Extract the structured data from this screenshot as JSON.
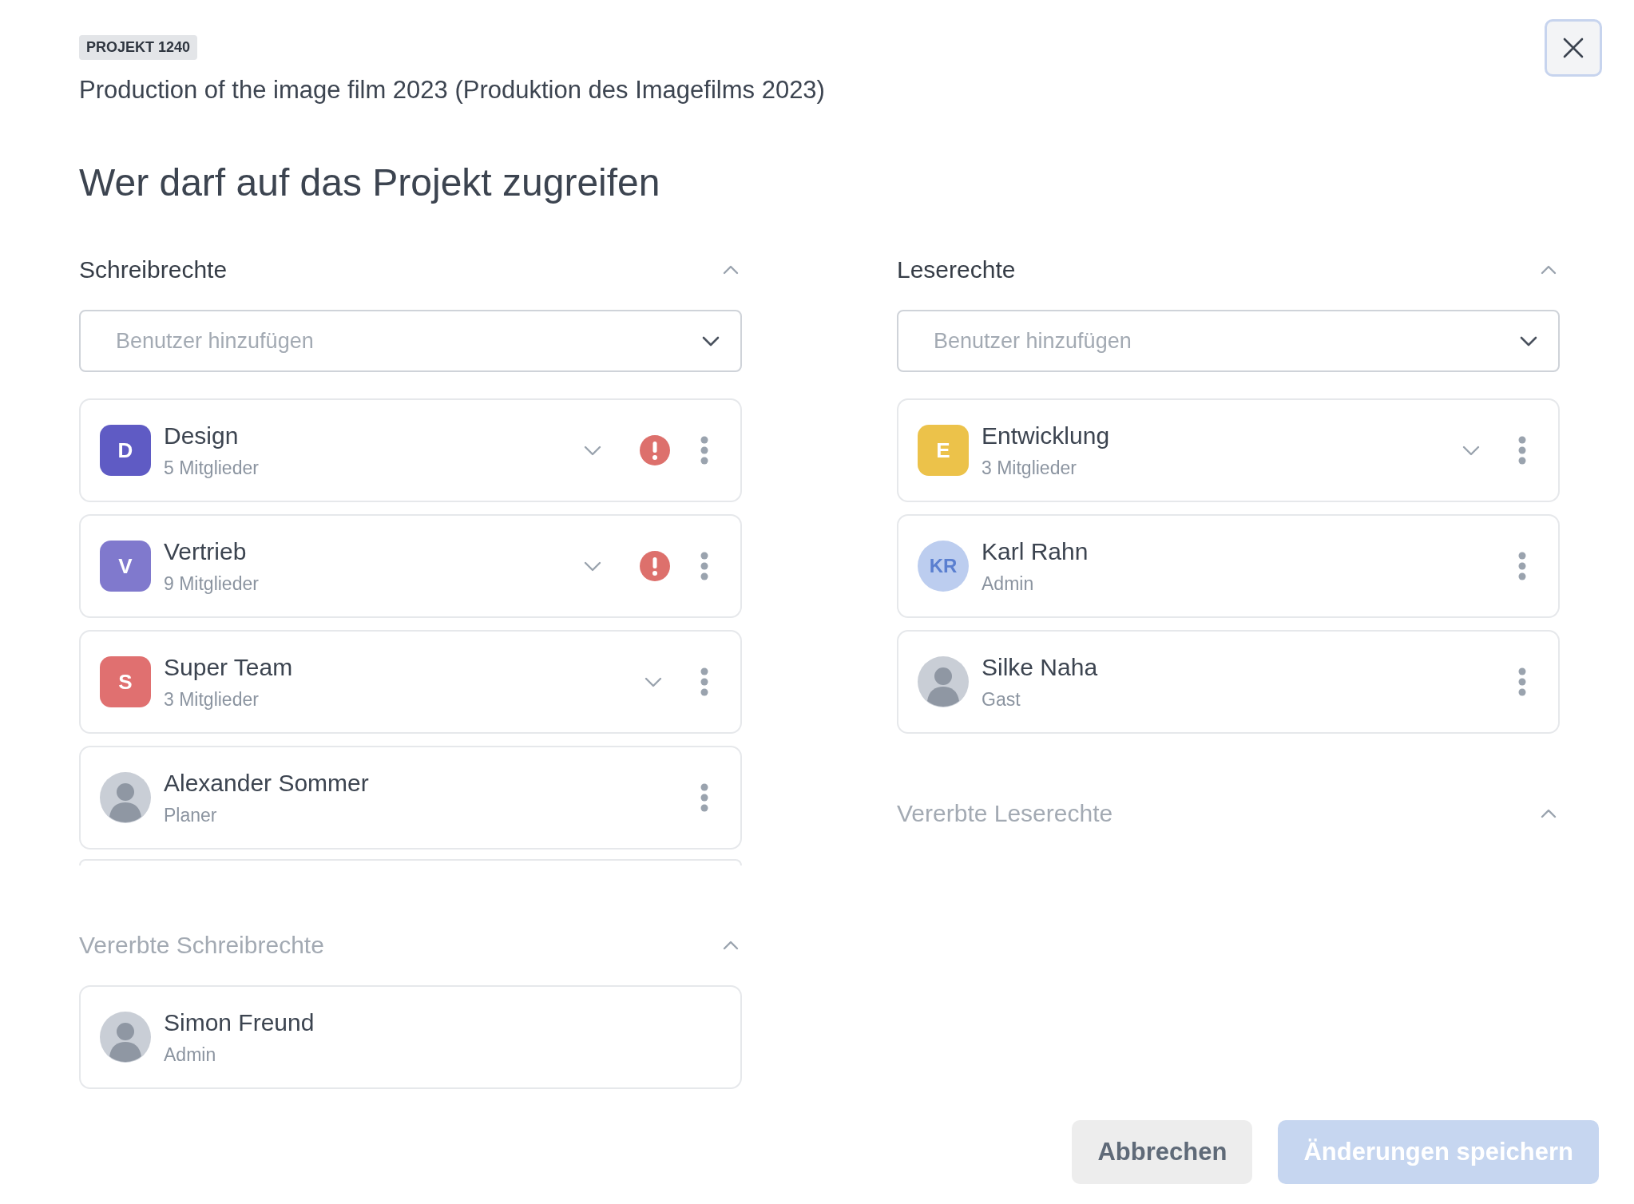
{
  "project_badge": "PROJEKT 1240",
  "project_title": "Production of the image film 2023 (Produktion des Imagefilms 2023)",
  "heading": "Wer darf auf das Projekt zugreifen",
  "columns": [
    {
      "title": "Schreibrechte",
      "expanded": true,
      "placeholder": "Benutzer hinzufügen",
      "more_below": true,
      "members": [
        {
          "kind": "group",
          "initial": "D",
          "color": "#5f5bc4",
          "name": "Design",
          "subtitle": "5 Mitglieder",
          "warning": true
        },
        {
          "kind": "group",
          "initial": "V",
          "color": "#8079cd",
          "name": "Vertrieb",
          "subtitle": "9 Mitglieder",
          "warning": true
        },
        {
          "kind": "group",
          "initial": "S",
          "color": "#e07070",
          "name": "Super Team",
          "subtitle": "3 Mitglieder",
          "warning": false
        },
        {
          "kind": "photo",
          "name": "Alexander Sommer",
          "subtitle": "Planer"
        }
      ],
      "inherited": {
        "title": "Vererbte Schreibrechte",
        "expanded": true,
        "members": [
          {
            "kind": "photo",
            "name": "Simon Freund",
            "subtitle": "Admin"
          }
        ]
      }
    },
    {
      "title": "Leserechte",
      "expanded": true,
      "placeholder": "Benutzer hinzufügen",
      "members": [
        {
          "kind": "group",
          "initial": "E",
          "color": "#ecc24a",
          "name": "Entwicklung",
          "subtitle": "3 Mitglieder",
          "warning": false
        },
        {
          "kind": "initials",
          "initial": "KR",
          "name": "Karl Rahn",
          "subtitle": "Admin"
        },
        {
          "kind": "photo",
          "name": "Silke Naha",
          "subtitle": "Gast"
        }
      ],
      "inherited": {
        "title": "Vererbte Leserechte",
        "expanded": true
      }
    }
  ],
  "buttons": [
    {
      "kind": "secondary",
      "label": "Abbrechen",
      "disabled": false
    },
    {
      "kind": "primary",
      "label": "Änderungen speichern",
      "disabled": true
    }
  ]
}
